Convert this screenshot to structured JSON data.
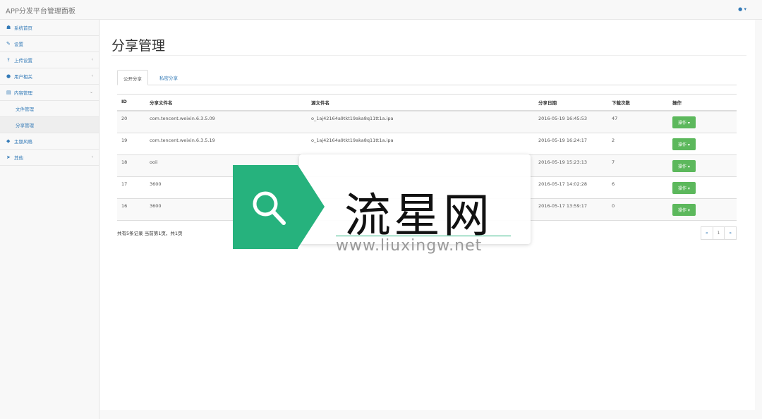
{
  "app": {
    "title": "APP分发平台管理面板",
    "user_icon": "user-icon",
    "user_caret": "▾"
  },
  "sidebar": {
    "items": [
      {
        "label": "系统首页",
        "icon": "dashboard-icon",
        "glyph": "☗"
      },
      {
        "label": "设置",
        "icon": "wrench-icon",
        "glyph": "✎"
      },
      {
        "label": "上传设置",
        "icon": "upload-icon",
        "glyph": "⇪",
        "chevron": "‹"
      },
      {
        "label": "用户相关",
        "icon": "user-icon",
        "glyph": "●",
        "chevron": "‹"
      },
      {
        "label": "内容管理",
        "icon": "content-icon",
        "glyph": "▤",
        "chevron": "⌄"
      },
      {
        "label": "文件管理"
      },
      {
        "label": "分享管理"
      },
      {
        "label": "主题风格",
        "icon": "theme-icon",
        "glyph": "◆"
      },
      {
        "label": "其他",
        "icon": "send-icon",
        "glyph": "➤",
        "chevron": "‹"
      }
    ]
  },
  "main": {
    "title": "分享管理",
    "tabs": [
      {
        "label": "公开分享"
      },
      {
        "label": "私密分享"
      }
    ],
    "table": {
      "headers": [
        "ID",
        "分享文件名",
        "源文件名",
        "分享日期",
        "下载次数",
        "操作"
      ],
      "rows": [
        {
          "id": "20",
          "share_name": "com.tencent.weixin.6.3.5.09",
          "source": "o_1aj42164a9tkt19aka8q11tt1a.ipa",
          "date": "2016-05-19 16:45:53",
          "downloads": "47",
          "action": "操作 ▾"
        },
        {
          "id": "19",
          "share_name": "com.tencent.weixin.6.3.5.19",
          "source": "o_1aj42164a9tkt19aka8q11tt1a.ipa",
          "date": "2016-05-19 16:24:17",
          "downloads": "2",
          "action": "操作 ▾"
        },
        {
          "id": "18",
          "share_name": "ooii",
          "source": "",
          "date": "2016-05-19 15:23:13",
          "downloads": "7",
          "action": "操作 ▾"
        },
        {
          "id": "17",
          "share_name": "3600",
          "source": "",
          "date": "2016-05-17 14:02:28",
          "downloads": "6",
          "action": "操作 ▾"
        },
        {
          "id": "16",
          "share_name": "3600",
          "source": "",
          "date": "2016-05-17 13:59:17",
          "downloads": "0",
          "action": "操作 ▾"
        }
      ]
    },
    "summary": "共有5条记录  当前第1页，共1页",
    "pager": {
      "prev": "«",
      "current": "1",
      "next": "»"
    }
  },
  "watermark": {
    "text": "流星网",
    "url": "www.liuxingw.net",
    "color": "#26b27d",
    "icon": "search-icon"
  }
}
